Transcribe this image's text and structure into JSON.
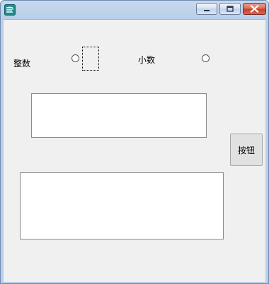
{
  "window": {
    "title": ""
  },
  "titlebar_buttons": {
    "minimize": "minimize-icon",
    "maximize": "maximize-icon",
    "close": "close-icon"
  },
  "form": {
    "integer_label": "整数",
    "decimal_label": "小数",
    "button_label": "按钮",
    "textbox_top_value": "",
    "textbox_bottom_value": ""
  }
}
